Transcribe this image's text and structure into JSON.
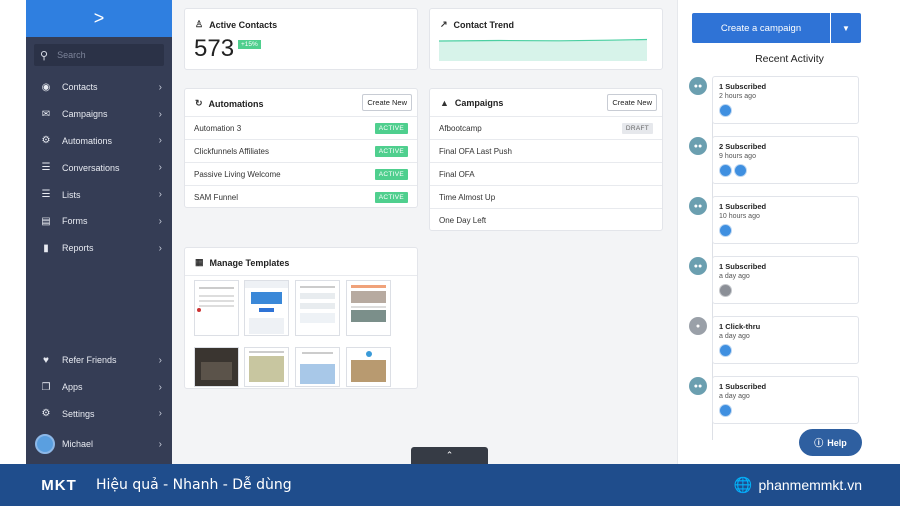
{
  "sidebar": {
    "search_placeholder": "Search",
    "items": [
      {
        "label": "Contacts",
        "icon": "contacts-icon"
      },
      {
        "label": "Campaigns",
        "icon": "campaigns-icon"
      },
      {
        "label": "Automations",
        "icon": "automations-icon"
      },
      {
        "label": "Conversations",
        "icon": "conversations-icon"
      },
      {
        "label": "Lists",
        "icon": "lists-icon"
      },
      {
        "label": "Forms",
        "icon": "forms-icon"
      },
      {
        "label": "Reports",
        "icon": "reports-icon"
      }
    ],
    "bottom_items": [
      {
        "label": "Refer Friends",
        "icon": "heart-icon"
      },
      {
        "label": "Apps",
        "icon": "apps-icon"
      },
      {
        "label": "Settings",
        "icon": "gear-icon"
      },
      {
        "label": "Michael",
        "icon": "avatar"
      }
    ]
  },
  "active_contacts": {
    "title": "Active Contacts",
    "count": "573",
    "change": "+15%"
  },
  "contact_trend": {
    "title": "Contact Trend"
  },
  "automations": {
    "title": "Automations",
    "create_label": "Create New",
    "rows": [
      {
        "name": "Automation 3",
        "status": "ACTIVE"
      },
      {
        "name": "Clickfunnels Affiliates",
        "status": "ACTIVE"
      },
      {
        "name": "Passive Living Welcome",
        "status": "ACTIVE"
      },
      {
        "name": "SAM Funnel",
        "status": "ACTIVE"
      }
    ]
  },
  "campaigns": {
    "title": "Campaigns",
    "create_label": "Create New",
    "rows": [
      {
        "name": "Afbootcamp",
        "status": "DRAFT"
      },
      {
        "name": "Final OFA Last Push",
        "status": ""
      },
      {
        "name": "Final OFA",
        "status": ""
      },
      {
        "name": "Time Almost Up",
        "status": ""
      },
      {
        "name": "One Day Left",
        "status": ""
      }
    ]
  },
  "templates": {
    "title": "Manage Templates"
  },
  "right_panel": {
    "create_campaign_label": "Create a campaign",
    "recent_activity_title": "Recent Activity",
    "activities": [
      {
        "title": "1 Subscribed",
        "time": "2 hours ago"
      },
      {
        "title": "2 Subscribed",
        "time": "9 hours ago"
      },
      {
        "title": "1 Subscribed",
        "time": "10 hours ago"
      },
      {
        "title": "1 Subscribed",
        "time": "a day ago"
      },
      {
        "title": "1 Click-thru",
        "time": "a day ago"
      },
      {
        "title": "1 Subscribed",
        "time": "a day ago"
      }
    ]
  },
  "help_label": "Help",
  "footer": {
    "logo_text": "MKT",
    "slogan": "Hiệu quả - Nhanh - Dễ dùng",
    "site": "phanmemmkt.vn"
  },
  "colors": {
    "accent": "#2f73d6",
    "sidebar": "#353d55",
    "active_badge": "#4fcf8e",
    "footer": "#1f4d8c"
  }
}
